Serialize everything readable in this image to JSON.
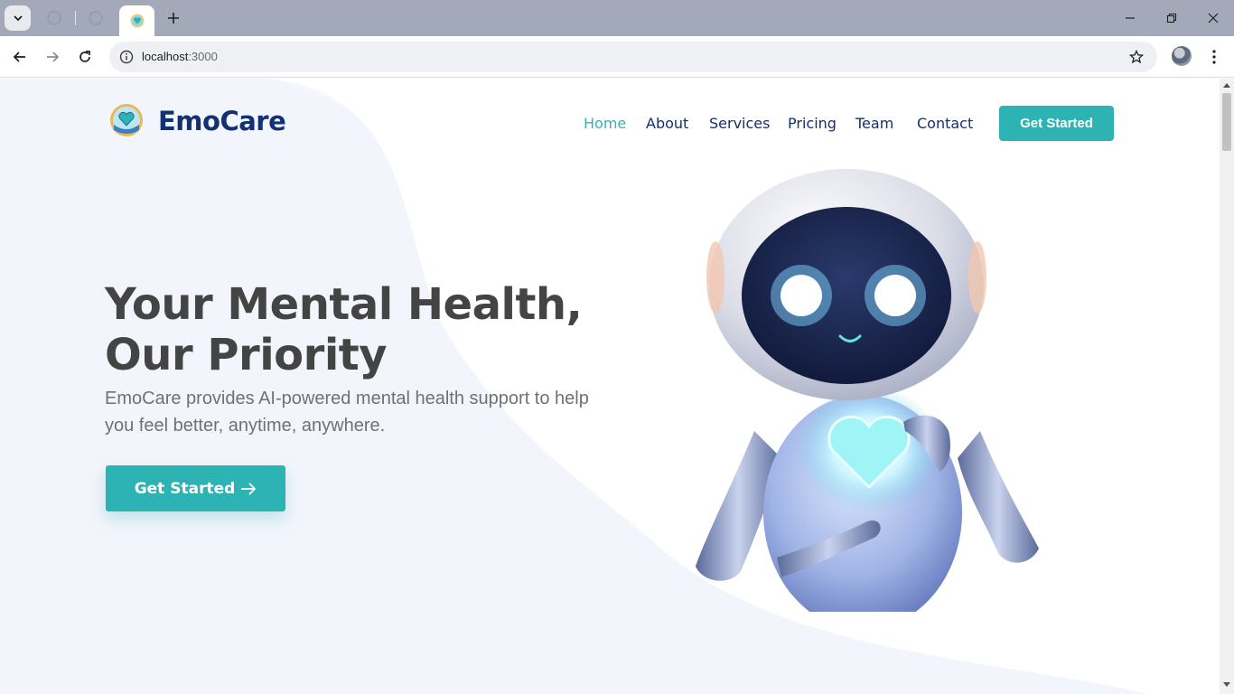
{
  "browser": {
    "url_host": "localhost",
    "url_port": ":3000",
    "tab_favicon": "emocare-logo-icon"
  },
  "site": {
    "brand": "EmoCare",
    "nav": [
      {
        "label": "Home",
        "active": true
      },
      {
        "label": "About",
        "active": false
      },
      {
        "label": "Services",
        "active": false
      },
      {
        "label": "Pricing",
        "active": false
      },
      {
        "label": "Team",
        "active": false
      },
      {
        "label": "Contact",
        "active": false
      }
    ],
    "header_cta": "Get Started"
  },
  "hero": {
    "title": "Your Mental Health, Our Priority",
    "description": "EmoCare provides AI-powered mental health support to help you feel better, anytime, anywhere.",
    "cta_label": "Get Started",
    "cta_icon": "arrow-right-icon",
    "image": "robot-with-heart-illustration"
  },
  "colors": {
    "brand_navy": "#113172",
    "accent_teal": "#2eb3b4",
    "heading": "#444444",
    "body_text": "#6f7176",
    "page_bg": "#f3f5fc"
  }
}
